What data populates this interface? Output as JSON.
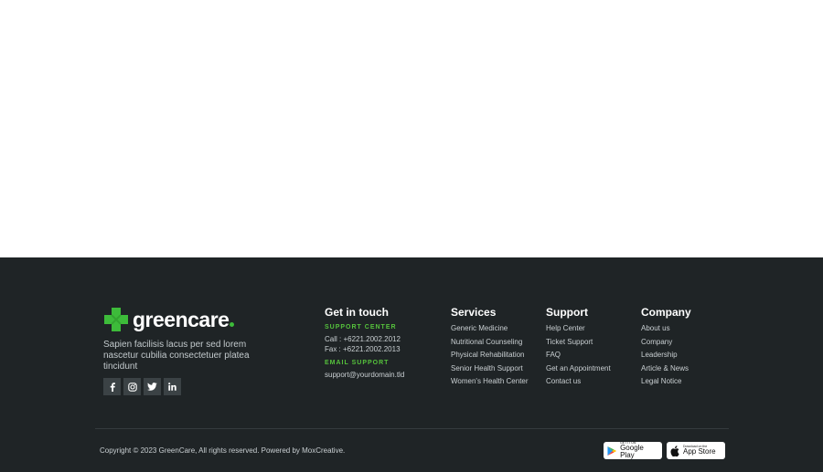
{
  "brand": {
    "name": "greencare",
    "tagline": "Sapien facilisis lacus per sed lorem nascetur cubilia consectetuer platea tincidunt",
    "accent_color": "#3dbb3a",
    "social": [
      "facebook-icon",
      "instagram-icon",
      "twitter-icon",
      "linkedin-icon"
    ]
  },
  "contact": {
    "title": "Get in touch",
    "support_label": "SUPPORT CENTER",
    "call": "Call : +6221.2002.2012",
    "fax": "Fax : +6221.2002.2013",
    "email_label": "EMAIL SUPPORT",
    "email": "support@yourdomain.tld"
  },
  "services": {
    "title": "Services",
    "items": [
      "Generic Medicine",
      "Nutritional Counseling",
      "Physical Rehabilitation",
      "Senior Health Support",
      "Women's Health Center"
    ]
  },
  "support": {
    "title": "Support",
    "items": [
      "Help Center",
      "Ticket Support",
      "FAQ",
      "Get an Appointment",
      "Contact us"
    ]
  },
  "company": {
    "title": "Company",
    "items": [
      "About us",
      "Company",
      "Leadership",
      "Article & News",
      "Legal Notice"
    ]
  },
  "bottom": {
    "copyright": "Copyright © 2023 GreenCare, All rights reserved. Powered by MoxCreative.",
    "google_play_small": "GET IT ON",
    "google_play_big": "Google Play",
    "app_store_small": "Download on the",
    "app_store_big": "App Store"
  },
  "colors": {
    "footer_bg": "#1f2426",
    "accent_green": "#55c23c"
  }
}
